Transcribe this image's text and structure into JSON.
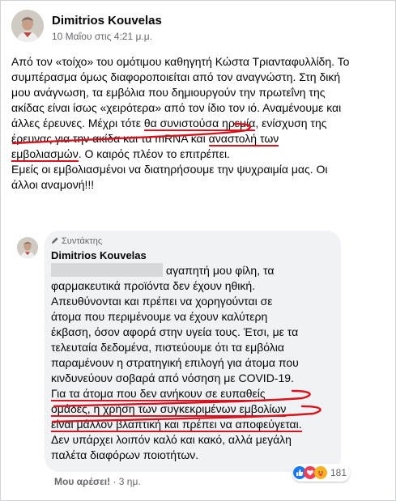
{
  "post": {
    "author": "Dimitrios Kouvelas",
    "time": "10 Μαΐου στις 4:21 μ.μ.",
    "paragraph_lines": [
      "Από τον «τοίχο» του ομότιμου καθηγητή Κώστα Τριανταφυλλίδη. Το",
      "συμπέρασμα όμως διαφοροποιείται από τον αναγνώστη. Στη δική",
      "μου ανάγνωση, τα εμβόλια που δημιουργούν την πρωτεΐνη της",
      "ακίδας είναι ίσως «χειρότερα» από τον ίδιο τον ιό. Αναμένουμε και",
      "άλλες έρευνες. Μέχρι τότε ",
      "θα συνιστούσα ηρεμία",
      ", ενίσχυση της",
      "έρευνας για την ακίδα και τα mRNA και ",
      "αναστολή των",
      "εμβολιασμών",
      ". Ο καιρός πλέον το επιτρέπει.",
      "Εμείς οι εμβολιασμένοι να διατηρήσουμε την ψυχραιμία μας. Οι",
      "άλλοι αναμονή!!!"
    ]
  },
  "comment": {
    "role": "Συντάκτης",
    "author": "Dimitrios Kouvelas",
    "lines": [
      "αγαπητή μου φίλη, τα",
      "φαρμακευτικά προϊόντα δεν έχουν ηθική.",
      "Απευθύνονται και πρέπει να χορηγούνται σε",
      "άτομα που περιμένουμε να έχουν καλύτερη",
      "έκβαση, όσον αφορά στην υγεία τους. Έτσι, με τα",
      "τελευταία δεδομένα, πιστεύουμε ότι τα εμβόλια",
      "παραμένουν η στρατηγική επιλογή για άτομα που",
      "κινδυνεύουν σοβαρά από νόσηση με COVID-19.",
      "Για τα άτομα που δεν ανήκουν σε ευπαθείς",
      "ομάδες, η χρήση των συγκεκριμένων εμβολίων",
      "είναι μάλλον βλαπτική και πρέπει να αποφεύγεται.",
      "Δεν υπάρχει λοιπόν καλό και κακό, αλλά μεγάλη",
      "παλέτα διαφόρων ποιοτήτων."
    ],
    "actions": {
      "like": "Μου αρέσει!",
      "separator": "·",
      "age": "3 ημ."
    },
    "reactions": {
      "icons": [
        "like-icon",
        "love-icon",
        "care-icon"
      ],
      "count": "181"
    }
  },
  "colors": {
    "annotation_red": "#d8131c",
    "like_blue": "#1877f2",
    "love_red": "#f33e58",
    "care_yellow": "#f7b125"
  }
}
